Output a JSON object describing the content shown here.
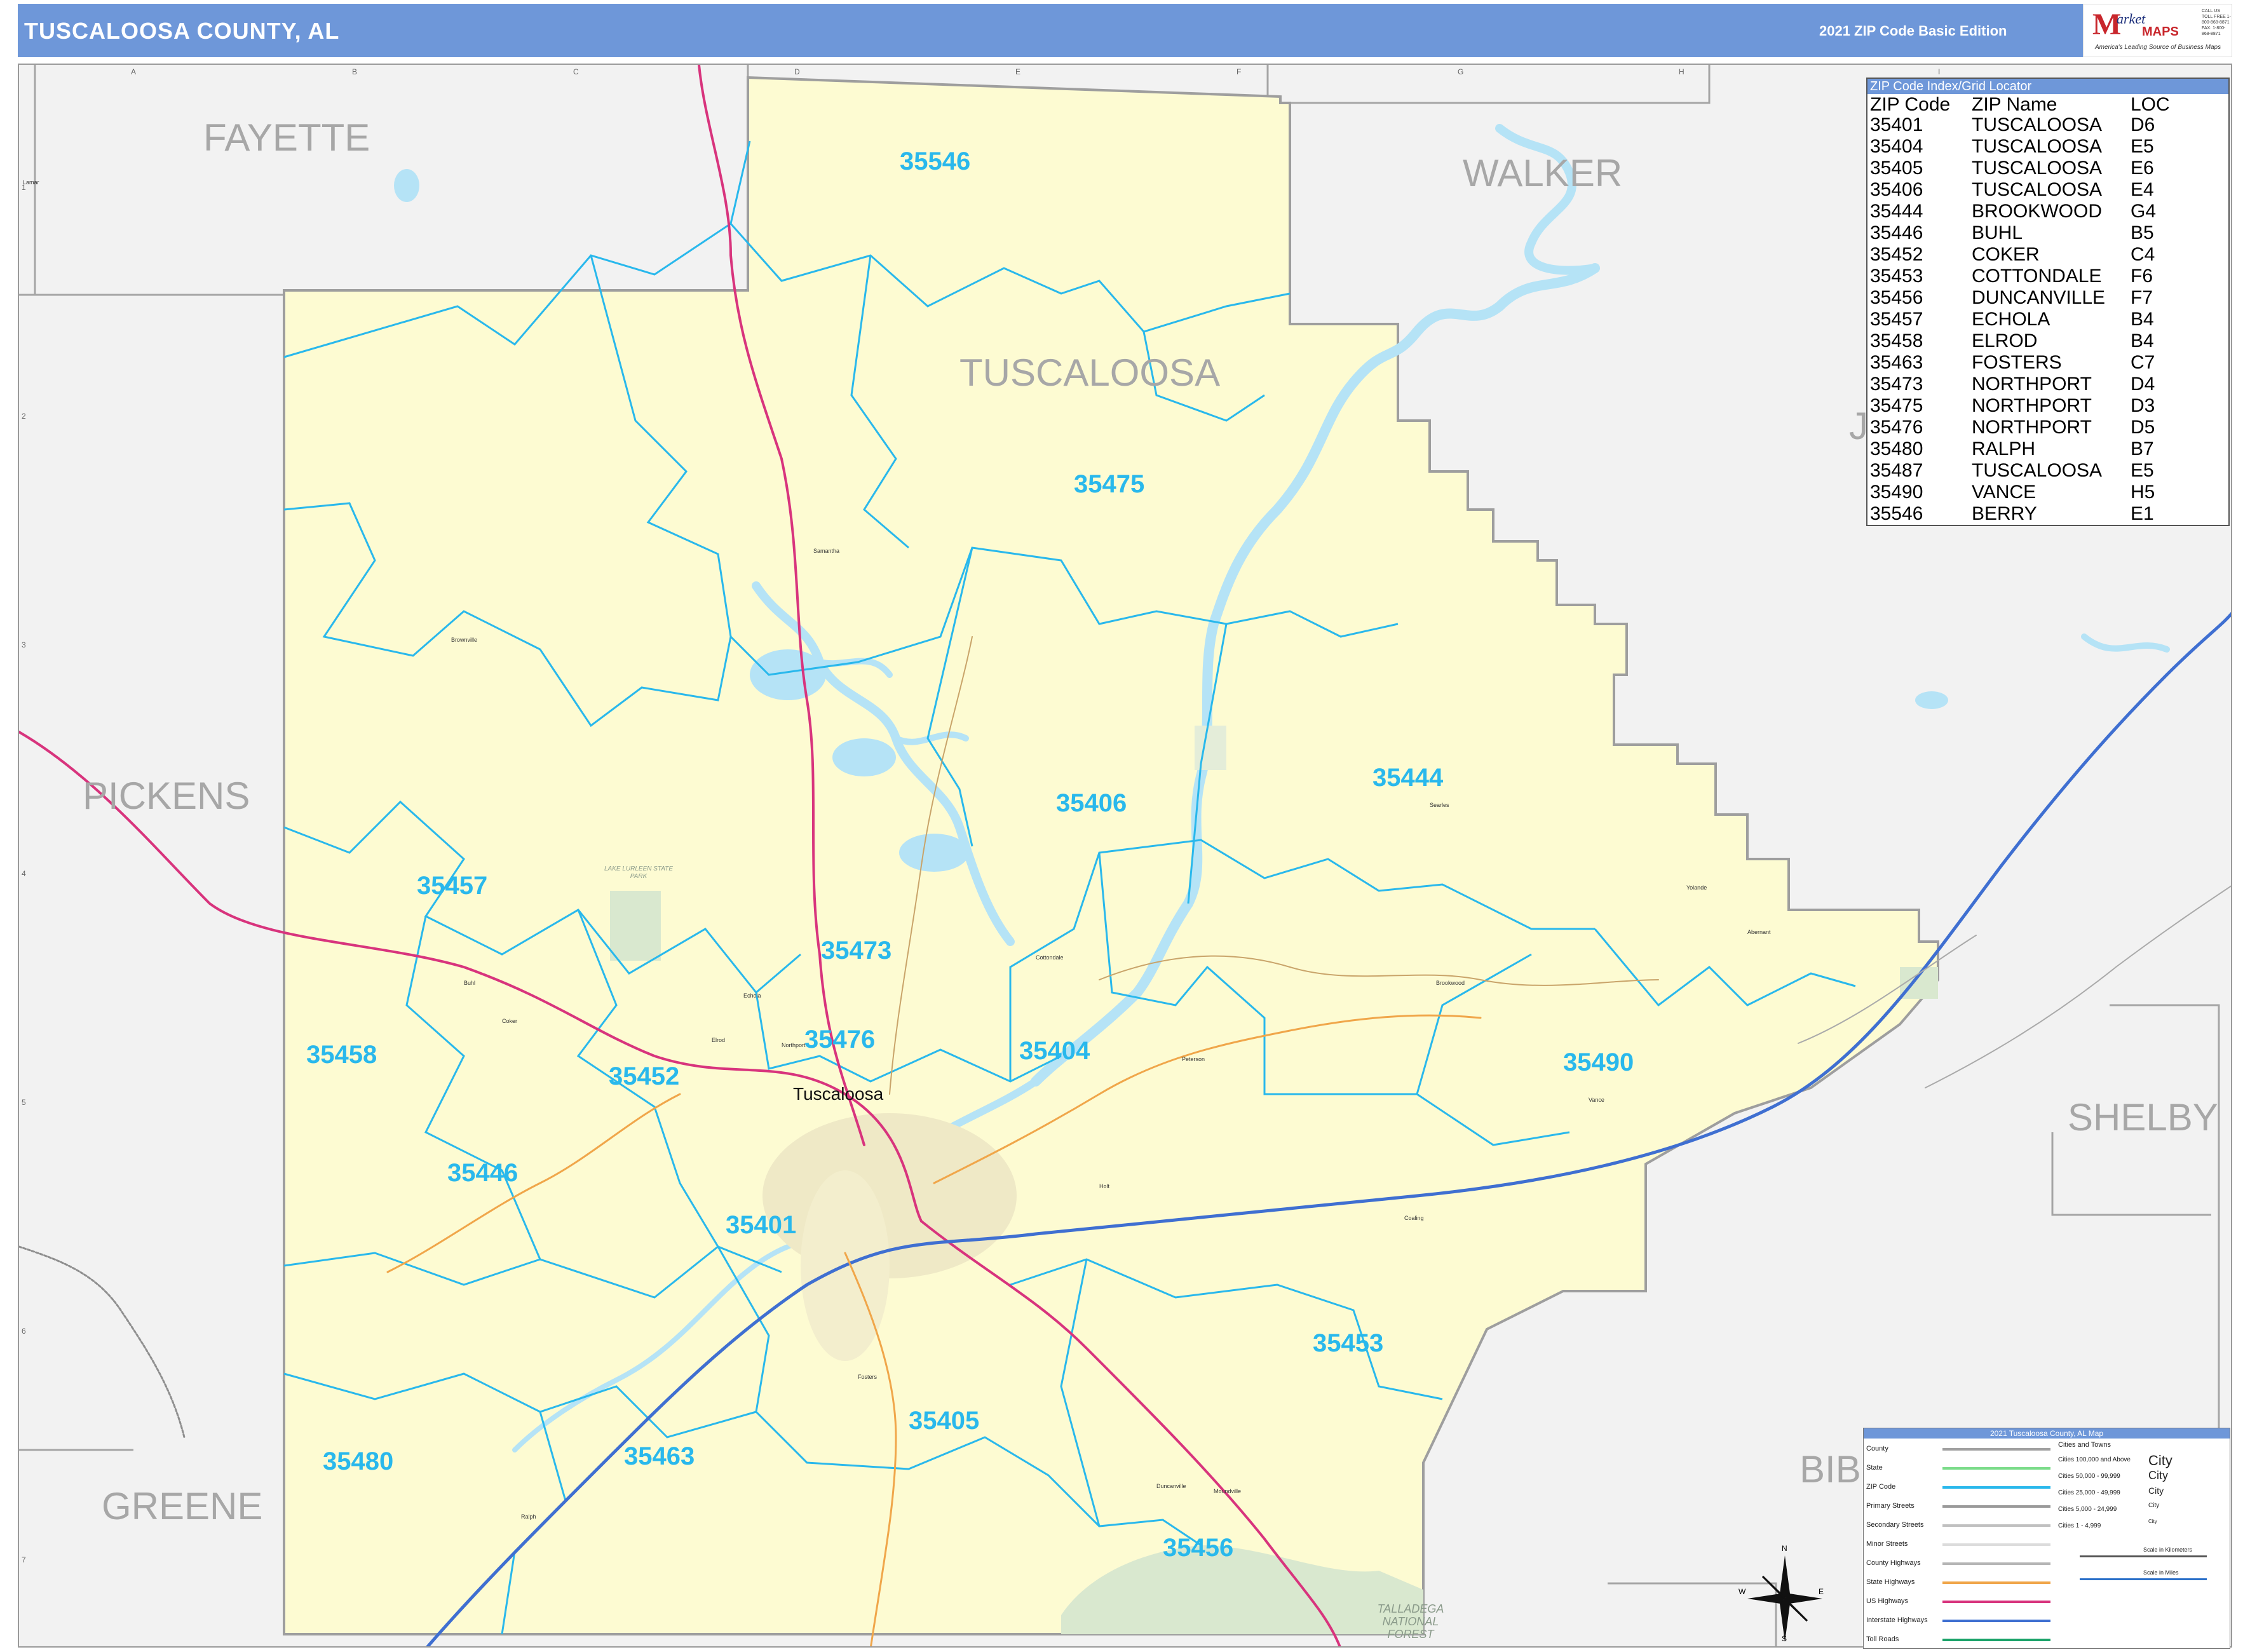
{
  "header": {
    "title": "TUSCALOOSA COUNTY, AL",
    "edition": "2021 ZIP Code Basic Edition",
    "logo": {
      "brand_letter": "M",
      "brand_text": "arket",
      "brand_maps": "MAPS",
      "tagline": "America's Leading Source of Business Maps",
      "contact": "CALL US TOLL FREE 1-800-868-8871 FAX: 1-800-868-8871"
    }
  },
  "grid": {
    "letters": [
      "A",
      "B",
      "C",
      "D",
      "E",
      "F",
      "G",
      "H",
      "I"
    ],
    "numbers": [
      "1",
      "2",
      "3",
      "4",
      "5",
      "6",
      "7"
    ]
  },
  "counties": {
    "fayette": "FAYETTE",
    "walker": "WALKER",
    "tuscaloosa": "TUSCALOOSA",
    "pickens": "PICKENS",
    "shelby": "SHELBY",
    "greene": "GREENE",
    "bibb": "BIB",
    "jefferson": "J"
  },
  "zips": {
    "z35546": "35546",
    "z35475": "35475",
    "z35406": "35406",
    "z35444": "35444",
    "z35457": "35457",
    "z35473": "35473",
    "z35476": "35476",
    "z35404": "35404",
    "z35458": "35458",
    "z35452": "35452",
    "z35490": "35490",
    "z35446": "35446",
    "z35401": "35401",
    "z35453": "35453",
    "z35405": "35405",
    "z35480": "35480",
    "z35463": "35463",
    "z35456": "35456"
  },
  "cities": {
    "tuscaloosa": "Tuscaloosa",
    "small": [
      "Brownville",
      "Samantha",
      "Northport",
      "Coker",
      "Buhl",
      "Elrod",
      "Echola",
      "Cottondale",
      "Duncanville",
      "Peterson",
      "Fosters",
      "Ralph",
      "Vance",
      "Brookwood",
      "Searles",
      "Holt",
      "Moundville",
      "Coaling",
      "Lamar",
      "Yolande",
      "Abernant"
    ]
  },
  "parks": {
    "lake_lurleen": "LAKE LURLEEN STATE PARK",
    "talladega": "TALLADEGA NATIONAL FOREST"
  },
  "zip_index": {
    "title": "ZIP Code Index/Grid Locator",
    "columns": [
      "ZIP Code",
      "ZIP Name",
      "LOC"
    ],
    "rows": [
      [
        "35401",
        "TUSCALOOSA",
        "D6"
      ],
      [
        "35404",
        "TUSCALOOSA",
        "E5"
      ],
      [
        "35405",
        "TUSCALOOSA",
        "E6"
      ],
      [
        "35406",
        "TUSCALOOSA",
        "E4"
      ],
      [
        "35444",
        "BROOKWOOD",
        "G4"
      ],
      [
        "35446",
        "BUHL",
        "B5"
      ],
      [
        "35452",
        "COKER",
        "C4"
      ],
      [
        "35453",
        "COTTONDALE",
        "F6"
      ],
      [
        "35456",
        "DUNCANVILLE",
        "F7"
      ],
      [
        "35457",
        "ECHOLA",
        "B4"
      ],
      [
        "35458",
        "ELROD",
        "B4"
      ],
      [
        "35463",
        "FOSTERS",
        "C7"
      ],
      [
        "35473",
        "NORTHPORT",
        "D4"
      ],
      [
        "35475",
        "NORTHPORT",
        "D3"
      ],
      [
        "35476",
        "NORTHPORT",
        "D5"
      ],
      [
        "35480",
        "RALPH",
        "B7"
      ],
      [
        "35487",
        "TUSCALOOSA",
        "E5"
      ],
      [
        "35490",
        "VANCE",
        "H5"
      ],
      [
        "35546",
        "BERRY",
        "E1"
      ]
    ]
  },
  "legend": {
    "title": "2021 Tuscaloosa County, AL Map",
    "items": [
      {
        "label": "County",
        "color": "#a0a0a0"
      },
      {
        "label": "State",
        "color": "#7bdc8a"
      },
      {
        "label": "ZIP Code",
        "color": "#29b8ec"
      },
      {
        "label": "Primary Streets",
        "color": "#9a9a9a"
      },
      {
        "label": "Secondary Streets",
        "color": "#c0c0c0"
      },
      {
        "label": "Minor Streets",
        "color": "#dcdcdc"
      },
      {
        "label": "County Highways",
        "color": "#b5b5b5"
      },
      {
        "label": "State Highways",
        "color": "#f0a64a"
      },
      {
        "label": "US Highways",
        "color": "#d8347d"
      },
      {
        "label": "Interstate Highways",
        "color": "#3f6fd1"
      },
      {
        "label": "Toll Roads",
        "color": "#1ca36a"
      }
    ],
    "cities_title": "Cities and Towns",
    "city_tiers": [
      {
        "label": "Cities 100,000 and Above",
        "sample": "City"
      },
      {
        "label": "Cities 50,000 - 99,999",
        "sample": "City"
      },
      {
        "label": "Cities 25,000 - 49,999",
        "sample": "City"
      },
      {
        "label": "Cities 5,000 - 24,999",
        "sample": "City"
      },
      {
        "label": "Cities 1 - 4,999",
        "sample": "City"
      }
    ],
    "scale_km": "Scale in Kilometers",
    "scale_mi": "Scale in Miles",
    "compass": {
      "n": "N",
      "s": "S",
      "e": "E",
      "w": "W"
    }
  },
  "colors": {
    "header": "#6e97d9",
    "county_fill": "#fdfbd2",
    "outside_fill": "#f2f2f2",
    "water": "#b5e3f6",
    "zip_line": "#29b8ec",
    "interstate": "#3f6fd1",
    "us_highway": "#d8347d",
    "state_highway": "#f0a64a"
  }
}
